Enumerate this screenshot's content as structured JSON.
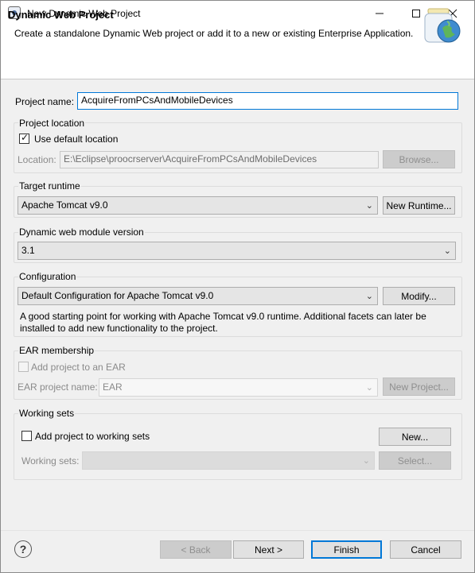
{
  "window": {
    "title": "New Dynamic Web Project",
    "minimize_icon": "minimize-icon",
    "maximize_icon": "maximize-icon",
    "close_icon": "close-icon"
  },
  "header": {
    "title": "Dynamic Web Project",
    "description": "Create a standalone Dynamic Web project or add it to a new or existing Enterprise Application."
  },
  "project_name": {
    "label": "Project name:",
    "value": "AcquireFromPCsAndMobileDevices"
  },
  "project_location": {
    "group_label": "Project location",
    "use_default_label": "Use default location",
    "use_default_checked": true,
    "location_label": "Location:",
    "location_value": "E:\\Eclipse\\proocrserver\\AcquireFromPCsAndMobileDevices",
    "browse_label": "Browse..."
  },
  "target_runtime": {
    "group_label": "Target runtime",
    "selected": "Apache Tomcat v9.0",
    "new_runtime_label": "New Runtime..."
  },
  "module_version": {
    "group_label": "Dynamic web module version",
    "selected": "3.1"
  },
  "configuration": {
    "group_label": "Configuration",
    "selected": "Default Configuration for Apache Tomcat v9.0",
    "modify_label": "Modify...",
    "description_line1": "A good starting point for working with Apache Tomcat v9.0 runtime. Additional facets can later be",
    "description_line2": "installed to add new functionality to the project."
  },
  "ear": {
    "group_label": "EAR membership",
    "add_label": "Add project to an EAR",
    "add_checked": false,
    "project_name_label": "EAR project name:",
    "project_name_value": "EAR",
    "new_project_label": "New Project..."
  },
  "working_sets": {
    "group_label": "Working sets",
    "add_label": "Add project to working sets",
    "add_checked": false,
    "new_label": "New...",
    "sets_label": "Working sets:",
    "sets_value": "",
    "select_label": "Select..."
  },
  "footer": {
    "back_label": "< Back",
    "next_label": "Next >",
    "finish_label": "Finish",
    "cancel_label": "Cancel"
  }
}
